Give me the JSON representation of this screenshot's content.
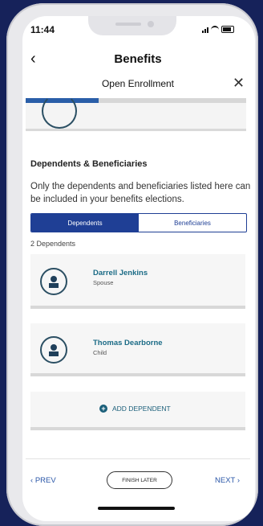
{
  "status": {
    "time": "11:44"
  },
  "nav": {
    "title": "Benefits"
  },
  "sheet": {
    "title": "Open Enrollment"
  },
  "progress": {
    "value": 0.33
  },
  "section": {
    "title": "Dependents & Beneficiaries",
    "description": "Only the dependents and beneficiaries listed here can be included in your benefits elections."
  },
  "tabs": [
    {
      "label": "Dependents",
      "active": true
    },
    {
      "label": "Beneficiaries",
      "active": false
    }
  ],
  "dependents_count": "2 Dependents",
  "dependents": [
    {
      "name": "Darrell Jenkins",
      "relationship": "Spouse"
    },
    {
      "name": "Thomas Dearborne",
      "relationship": "Child"
    }
  ],
  "add_dependent": {
    "label": "ADD DEPENDENT"
  },
  "footer": {
    "prev_label": "PREV",
    "finish_label": "FINISH LATER",
    "next_label": "NEXT"
  },
  "colors": {
    "background": "#16225a",
    "primary_blue": "#1f3f95",
    "link_blue": "#2b57a8",
    "teal_text": "#1b6b86"
  },
  "icons": [
    "back-icon",
    "close-icon",
    "person-icon",
    "add-icon",
    "chevron-left-icon",
    "chevron-right-icon"
  ]
}
